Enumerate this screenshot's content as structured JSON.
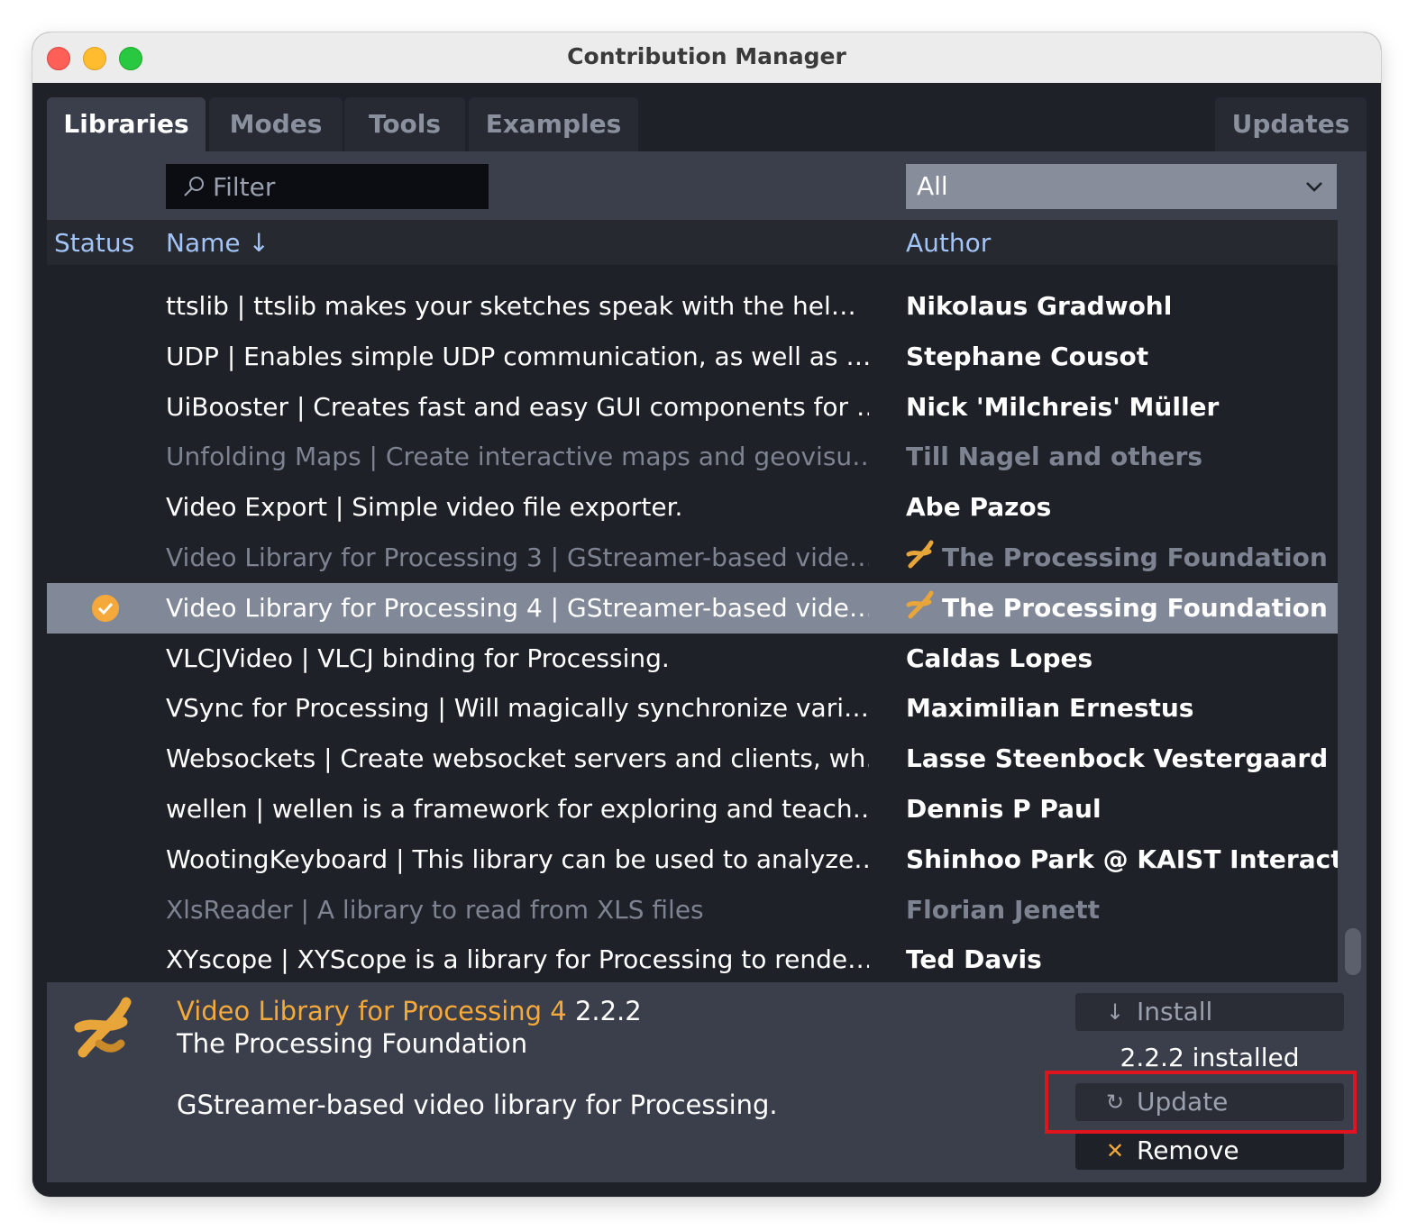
{
  "window": {
    "title": "Contribution Manager"
  },
  "tabs": [
    {
      "label": "Libraries",
      "active": true
    },
    {
      "label": "Modes"
    },
    {
      "label": "Tools"
    },
    {
      "label": "Examples"
    },
    {
      "label": "Updates"
    }
  ],
  "filter": {
    "placeholder": "Filter",
    "icon": "search-icon"
  },
  "category_select": {
    "value": "All",
    "icon": "chevron-down-icon"
  },
  "table": {
    "columns": {
      "status": "Status",
      "name": "Name",
      "sort_indicator": "↓",
      "author": "Author"
    },
    "rows": [
      {
        "name": "ttslib | ttslib makes your sketches speak with the hel…",
        "author": "Nikolaus Gradwohl"
      },
      {
        "name": "UDP | Enables simple UDP communication, as well as …",
        "author": "Stephane Cousot"
      },
      {
        "name": "UiBooster | Creates fast and easy GUI components for …",
        "author": "Nick 'Milchreis' Müller"
      },
      {
        "name": "Unfolding Maps | Create interactive maps and geovisu…",
        "author": "Till Nagel and others",
        "dim": true
      },
      {
        "name": "Video Export | Simple video file exporter.",
        "author": "Abe Pazos"
      },
      {
        "name": "Video Library for Processing 3 | GStreamer-based vide…",
        "author": "The Processing Foundation",
        "dim": true,
        "foundation": true
      },
      {
        "name": "Video Library for Processing 4 | GStreamer-based vide…",
        "author": "The Processing Foundation",
        "selected": true,
        "installed": true,
        "foundation": true
      },
      {
        "name": "VLCJVideo | VLCJ binding for Processing.",
        "author": "Caldas Lopes"
      },
      {
        "name": "VSync for Processing | Will magically synchronize vari…",
        "author": "Maximilian Ernestus"
      },
      {
        "name": "Websockets | Create websocket servers and clients, wh…",
        "author": "Lasse Steenbock Vestergaard"
      },
      {
        "name": "wellen | wellen is a framework for exploring and teach…",
        "author": "Dennis P Paul"
      },
      {
        "name": "WootingKeyboard | This library can be used to analyze…",
        "author": "Shinhoo Park @ KAIST Interacti…"
      },
      {
        "name": "XlsReader | A library to read from XLS files",
        "author": "Florian Jenett",
        "dim": true
      },
      {
        "name": "XYscope | XYScope is a library for Processing to rende…",
        "author": "Ted Davis"
      }
    ]
  },
  "detail": {
    "library_name": "Video Library for Processing 4",
    "version": "2.2.2",
    "author": "The Processing Foundation",
    "description": "GStreamer-based video library for Processing.",
    "installed_text": "2.2.2 installed",
    "install_label": "Install",
    "update_label": "Update",
    "remove_label": "Remove"
  },
  "colors": {
    "accent": "#f5a93b",
    "header_text": "#a3c4f7",
    "highlight": "#e0141e"
  }
}
